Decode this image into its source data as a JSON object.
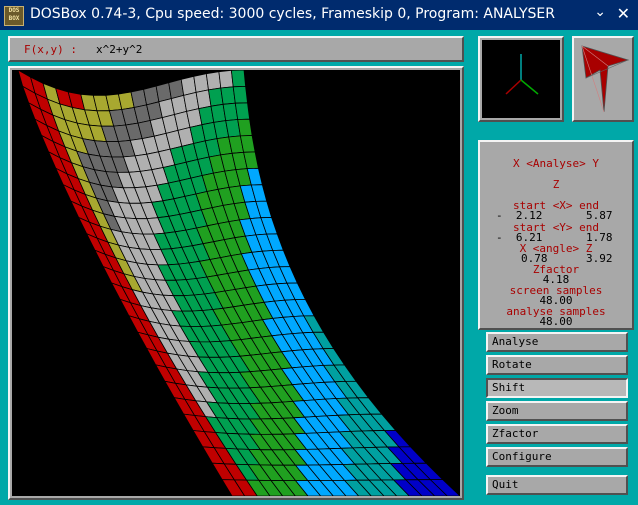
{
  "window": {
    "title": "DOSBox 0.74-3, Cpu speed: 3000 cycles, Frameskip 0, Program: ANALYSER",
    "icon_text": [
      "DOS",
      "BOX"
    ],
    "minimize_icon": "chevron-down-icon",
    "close_icon": "close-icon"
  },
  "function_bar": {
    "label": "F(x,y) :",
    "expression": "x^2+y^2"
  },
  "info": {
    "header": "X <Analyse> Y",
    "z_label": "Z",
    "x_range_label": "start <X> end",
    "x_start": "-  2.12",
    "x_end": "5.87",
    "y_range_label": "start <Y> end",
    "y_start": "-  6.21",
    "y_end": "1.78",
    "angle_label": "X <angle> Z",
    "angle_x": "0.78",
    "angle_z": "3.92",
    "zfactor_label": "Zfactor",
    "zfactor_value": "4.18",
    "screen_samples_label": "screen samples",
    "screen_samples_value": "48.00",
    "analyse_samples_label": "analyse samples",
    "analyse_samples_value": "48.00"
  },
  "buttons": {
    "analyse": "Analyse",
    "rotate": "Rotate",
    "shift": "Shift",
    "zoom": "Zoom",
    "zfactor": "Zfactor",
    "configure": "Configure",
    "quit": "Quit"
  },
  "colors": {
    "background": "#00a8a8",
    "panel": "#a8a8a8",
    "titlebar": "#002b6e",
    "label_red": "#a80000",
    "surface_bands": [
      "#c00000",
      "#a8a830",
      "#6a6a6a",
      "#b0b0b0",
      "#00a050",
      "#20a020",
      "#00a8ff",
      "#00a0a0",
      "#0000c8"
    ]
  },
  "surface_plot": {
    "band_count": 9,
    "visible_rows": 26,
    "visible_cols": 18
  }
}
